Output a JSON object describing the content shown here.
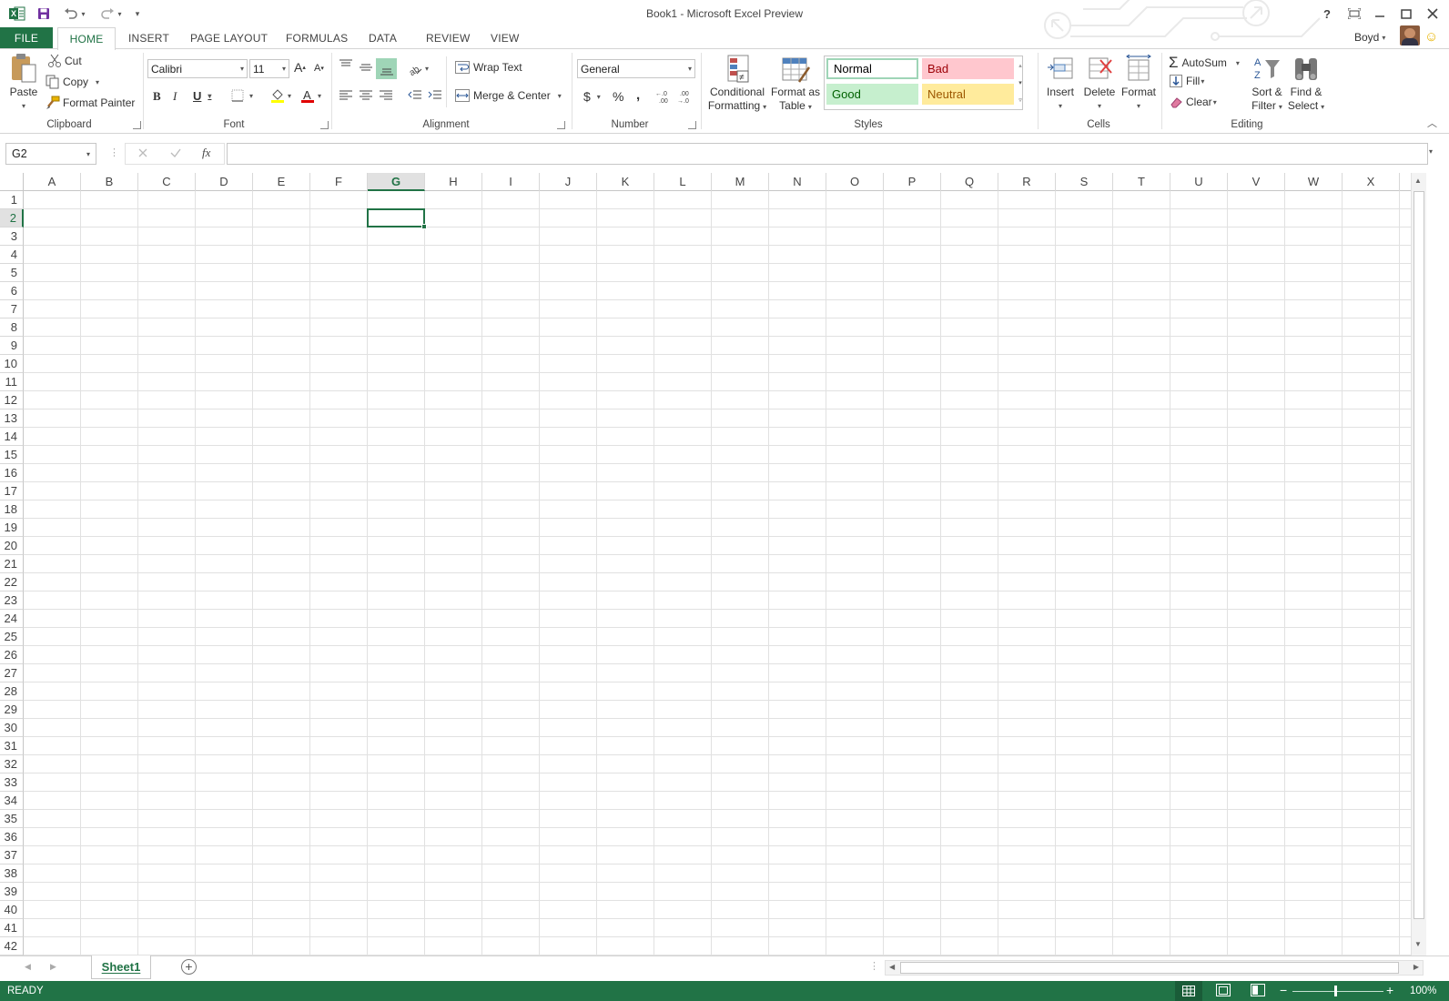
{
  "window": {
    "title": "Book1 - Microsoft Excel Preview",
    "user": "Boyd"
  },
  "qat": {
    "app_icon": "excel-icon",
    "save_icon": "save-icon",
    "undo_icon": "undo-icon",
    "redo_icon": "redo-icon",
    "customize_icon": "customize-qat-icon"
  },
  "window_controls": {
    "help": "?",
    "ribbon_display": "ribbon-display-icon",
    "minimize": "minimize-icon",
    "restore": "restore-icon",
    "close": "close-icon"
  },
  "tabs": [
    {
      "label": "FILE"
    },
    {
      "label": "HOME"
    },
    {
      "label": "INSERT"
    },
    {
      "label": "PAGE LAYOUT"
    },
    {
      "label": "FORMULAS"
    },
    {
      "label": "DATA"
    },
    {
      "label": "REVIEW"
    },
    {
      "label": "VIEW"
    }
  ],
  "clipboard": {
    "label": "Clipboard",
    "paste": "Paste",
    "cut": "Cut",
    "copy": "Copy",
    "format_painter": "Format Painter"
  },
  "font": {
    "label": "Font",
    "name": "Calibri",
    "size": "11",
    "bold": "B",
    "italic": "I",
    "underline": "U",
    "font_color": "#e00000",
    "highlight_color": "#ffff00"
  },
  "alignment": {
    "label": "Alignment",
    "wrap_text": "Wrap Text",
    "merge_center": "Merge & Center"
  },
  "number": {
    "label": "Number",
    "format": "General",
    "currency": "$",
    "percent": "%",
    "comma": ","
  },
  "styles": {
    "label": "Styles",
    "conditional_formatting": [
      "Conditional",
      "Formatting"
    ],
    "format_as_table": [
      "Format as",
      "Table"
    ],
    "cells": [
      {
        "name": "Normal",
        "bg": "#ffffff",
        "fg": "#000000"
      },
      {
        "name": "Bad",
        "bg": "#ffc7ce",
        "fg": "#9c0006"
      },
      {
        "name": "Good",
        "bg": "#c6efce",
        "fg": "#006100"
      },
      {
        "name": "Neutral",
        "bg": "#ffeb9c",
        "fg": "#9c5700"
      }
    ]
  },
  "cells_group": {
    "label": "Cells",
    "insert": "Insert",
    "delete": "Delete",
    "format": "Format"
  },
  "editing": {
    "label": "Editing",
    "autosum": "AutoSum",
    "fill": "Fill",
    "clear": "Clear",
    "sort_filter": [
      "Sort &",
      "Filter"
    ],
    "find_select": [
      "Find &",
      "Select"
    ]
  },
  "formula_bar": {
    "name_box": "G2",
    "fx": "fx",
    "value": ""
  },
  "columns": [
    "A",
    "B",
    "C",
    "D",
    "E",
    "F",
    "G",
    "H",
    "I",
    "J",
    "K",
    "L",
    "M",
    "N",
    "O",
    "P",
    "Q",
    "R",
    "S",
    "T",
    "U",
    "V",
    "W",
    "X"
  ],
  "rows": [
    "1",
    "2",
    "3",
    "4",
    "5",
    "6",
    "7",
    "8",
    "9",
    "10",
    "11",
    "12",
    "13",
    "14",
    "15",
    "16",
    "17",
    "18",
    "19",
    "20",
    "21",
    "22",
    "23",
    "24",
    "25",
    "26",
    "27",
    "28",
    "29",
    "30",
    "31",
    "32",
    "33",
    "34",
    "35",
    "36",
    "37",
    "38",
    "39",
    "40",
    "41",
    "42"
  ],
  "selected": {
    "column": "G",
    "row": "2"
  },
  "sheets": [
    {
      "name": "Sheet1"
    }
  ],
  "status": {
    "text": "READY",
    "zoom": "100%"
  },
  "colors": {
    "accent": "#217346"
  }
}
